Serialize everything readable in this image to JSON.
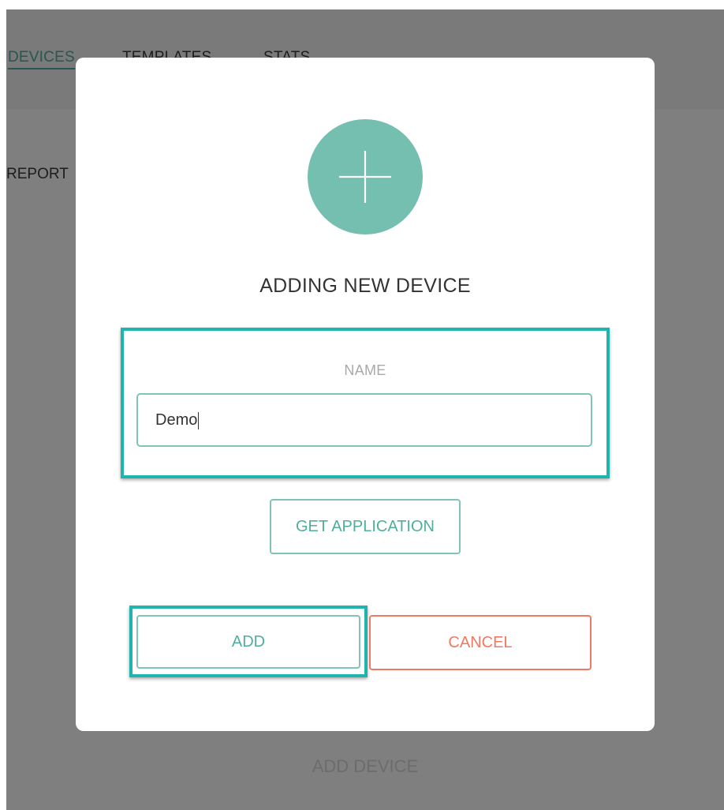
{
  "background": {
    "tabs": [
      "DEVICES",
      "TEMPLATES",
      "STATS"
    ],
    "report_label": "REPORT",
    "add_device_label": "ADD DEVICE"
  },
  "modal": {
    "title": "ADDING NEW DEVICE",
    "name_label": "NAME",
    "name_value": "Demo",
    "get_application_label": "GET APPLICATION",
    "add_label": "ADD",
    "cancel_label": "CANCEL"
  },
  "colors": {
    "accent": "#74bfb0",
    "highlight": "#1fb5ae",
    "cancel": "#ef7a63"
  }
}
